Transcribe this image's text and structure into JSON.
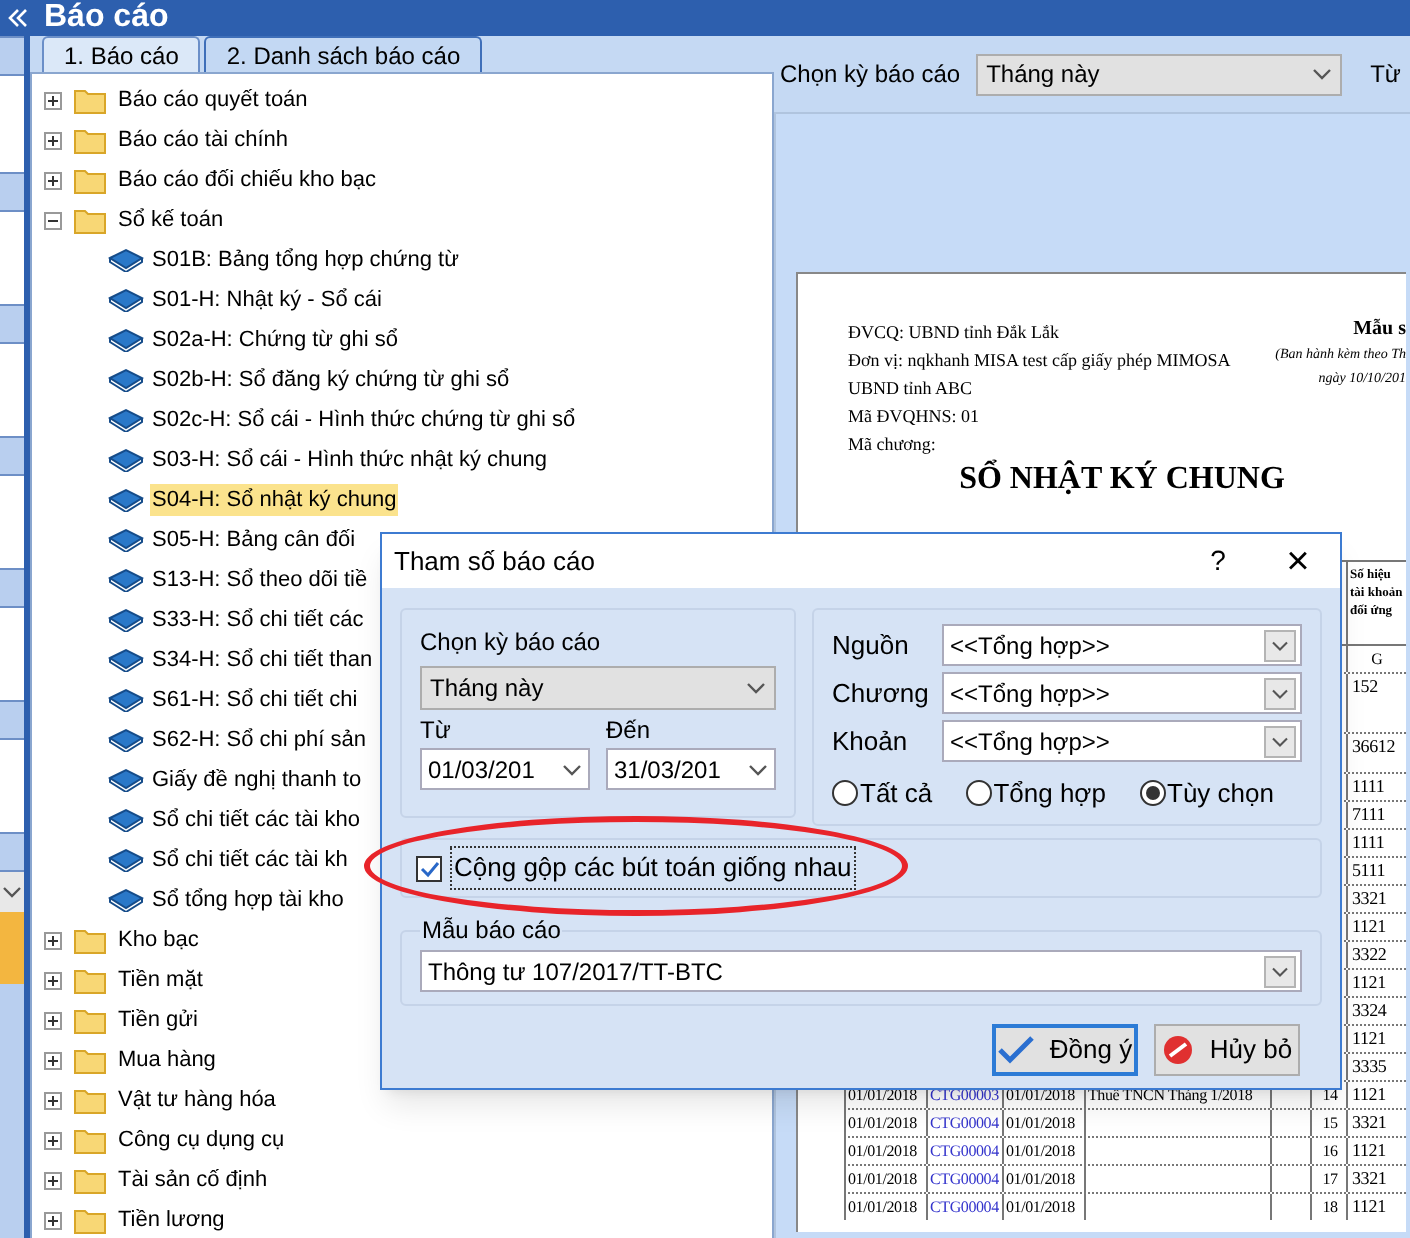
{
  "window": {
    "title": "Báo cáo"
  },
  "tabs": [
    {
      "label": "1. Báo cáo",
      "selected": true
    },
    {
      "label": "2. Danh sách báo cáo",
      "selected": false
    }
  ],
  "tree": [
    {
      "label": "Báo cáo quyết toán",
      "expanded": false
    },
    {
      "label": "Báo cáo tài chính",
      "expanded": false
    },
    {
      "label": "Báo cáo đối chiếu kho bạc",
      "expanded": false
    },
    {
      "label": "Sổ kế toán",
      "expanded": true,
      "children": [
        {
          "label": "S01B: Bảng tổng hợp chứng từ",
          "selected": false
        },
        {
          "label": "S01-H: Nhật ký - Sổ cái",
          "selected": false
        },
        {
          "label": "S02a-H: Chứng từ ghi sổ",
          "selected": false
        },
        {
          "label": "S02b-H: Sổ đăng ký chứng từ ghi sổ",
          "selected": false
        },
        {
          "label": "S02c-H: Sổ cái - Hình thức chứng từ ghi sổ",
          "selected": false
        },
        {
          "label": "S03-H: Sổ cái - Hình thức nhật ký chung",
          "selected": false
        },
        {
          "label": "S04-H: Sổ nhật ký chung",
          "selected": true
        },
        {
          "label": "S05-H: Bảng cân đối",
          "selected": false
        },
        {
          "label": "S13-H: Sổ theo dõi tiề",
          "selected": false
        },
        {
          "label": "S33-H: Sổ chi tiết các",
          "selected": false
        },
        {
          "label": "S34-H: Sổ chi tiết than",
          "selected": false
        },
        {
          "label": "S61-H: Sổ chi tiết chi",
          "selected": false
        },
        {
          "label": "S62-H: Sổ chi phí sản",
          "selected": false
        },
        {
          "label": "Giấy đề nghị thanh to",
          "selected": false
        },
        {
          "label": "Sổ chi tiết các tài kho",
          "selected": false
        },
        {
          "label": "Sổ chi tiết các tài kh",
          "selected": false
        },
        {
          "label": "Sổ tổng hợp tài kho",
          "selected": false
        }
      ]
    },
    {
      "label": "Kho bạc",
      "expanded": false
    },
    {
      "label": "Tiền mặt",
      "expanded": false
    },
    {
      "label": "Tiền gửi",
      "expanded": false
    },
    {
      "label": "Mua hàng",
      "expanded": false
    },
    {
      "label": "Vật tư hàng hóa",
      "expanded": false
    },
    {
      "label": "Công cụ dụng cụ",
      "expanded": false
    },
    {
      "label": "Tài sản cố định",
      "expanded": false
    },
    {
      "label": "Tiền lương",
      "expanded": false
    }
  ],
  "toolbar": {
    "period_label": "Chọn kỳ báo cáo",
    "period_value": "Tháng này",
    "from_label": "Từ"
  },
  "report": {
    "header_lines": [
      "ĐVCQ: UBND tỉnh Đắk Lắk",
      "Đơn vị: nqkhanh MISA test cấp giấy phép MIMOSA",
      "UBND tỉnh ABC",
      "Mã ĐVQHNS: 01",
      "Mã chương:"
    ],
    "form_lines": [
      "Mẫu s",
      "(Ban hành kèm theo Th",
      "ngày 10/10/201"
    ],
    "title": "SỔ NHẬT KÝ CHUNG",
    "account_header": "Số hiệu tài khoản đối ứng",
    "account_code_header": "G",
    "rows": [
      {
        "account": "152"
      },
      {
        "account": "36612"
      },
      {
        "account": "1111"
      },
      {
        "account": "7111"
      },
      {
        "account": "1111"
      },
      {
        "account": "5111"
      },
      {
        "account": "3321"
      },
      {
        "account": "1121"
      },
      {
        "account": "3322"
      },
      {
        "account": "1121"
      },
      {
        "account": "3324"
      },
      {
        "account": "1121"
      },
      {
        "account": "3335"
      },
      {
        "date": "01/01/2018",
        "voucher": "CTG00003",
        "voucher_date": "01/01/2018",
        "description": "Thuế TNCN Tháng 1/2018",
        "line": "14",
        "account": "1121"
      },
      {
        "date": "01/01/2018",
        "voucher": "CTG00004",
        "voucher_date": "01/01/2018",
        "line": "15",
        "account": "3321"
      },
      {
        "date": "01/01/2018",
        "voucher": "CTG00004",
        "voucher_date": "01/01/2018",
        "line": "16",
        "account": "1121"
      },
      {
        "date": "01/01/2018",
        "voucher": "CTG00004",
        "voucher_date": "01/01/2018",
        "line": "17",
        "account": "3321"
      },
      {
        "date": "01/01/2018",
        "voucher": "CTG00004",
        "voucher_date": "01/01/2018",
        "line": "18",
        "account": "1121"
      }
    ]
  },
  "dialog": {
    "title": "Tham số báo cáo",
    "help": "?",
    "close": "×",
    "period_label": "Chọn kỳ báo cáo",
    "period_value": "Tháng này",
    "from_label": "Từ",
    "from_value": "01/03/201",
    "to_label": "Đến",
    "to_value": "31/03/201",
    "filters": [
      {
        "label": "Nguồn",
        "value": "<<Tổng hợp>>"
      },
      {
        "label": "Chương",
        "value": "<<Tổng hợp>>"
      },
      {
        "label": "Khoản",
        "value": "<<Tổng hợp>>"
      }
    ],
    "radios": [
      {
        "label": "Tất cả",
        "selected": false
      },
      {
        "label": "Tổng hợp",
        "selected": false
      },
      {
        "label": "Tùy chọn",
        "selected": true
      }
    ],
    "merge": {
      "label": "Cộng gộp các bút toán giống nhau",
      "checked": true
    },
    "template_label": "Mẫu báo cáo",
    "template_value": "Thông tư 107/2017/TT-BTC",
    "buttons": [
      {
        "kind": "ok",
        "label": "Đồng ý"
      },
      {
        "kind": "cancel",
        "label": "Hủy bỏ"
      }
    ]
  }
}
